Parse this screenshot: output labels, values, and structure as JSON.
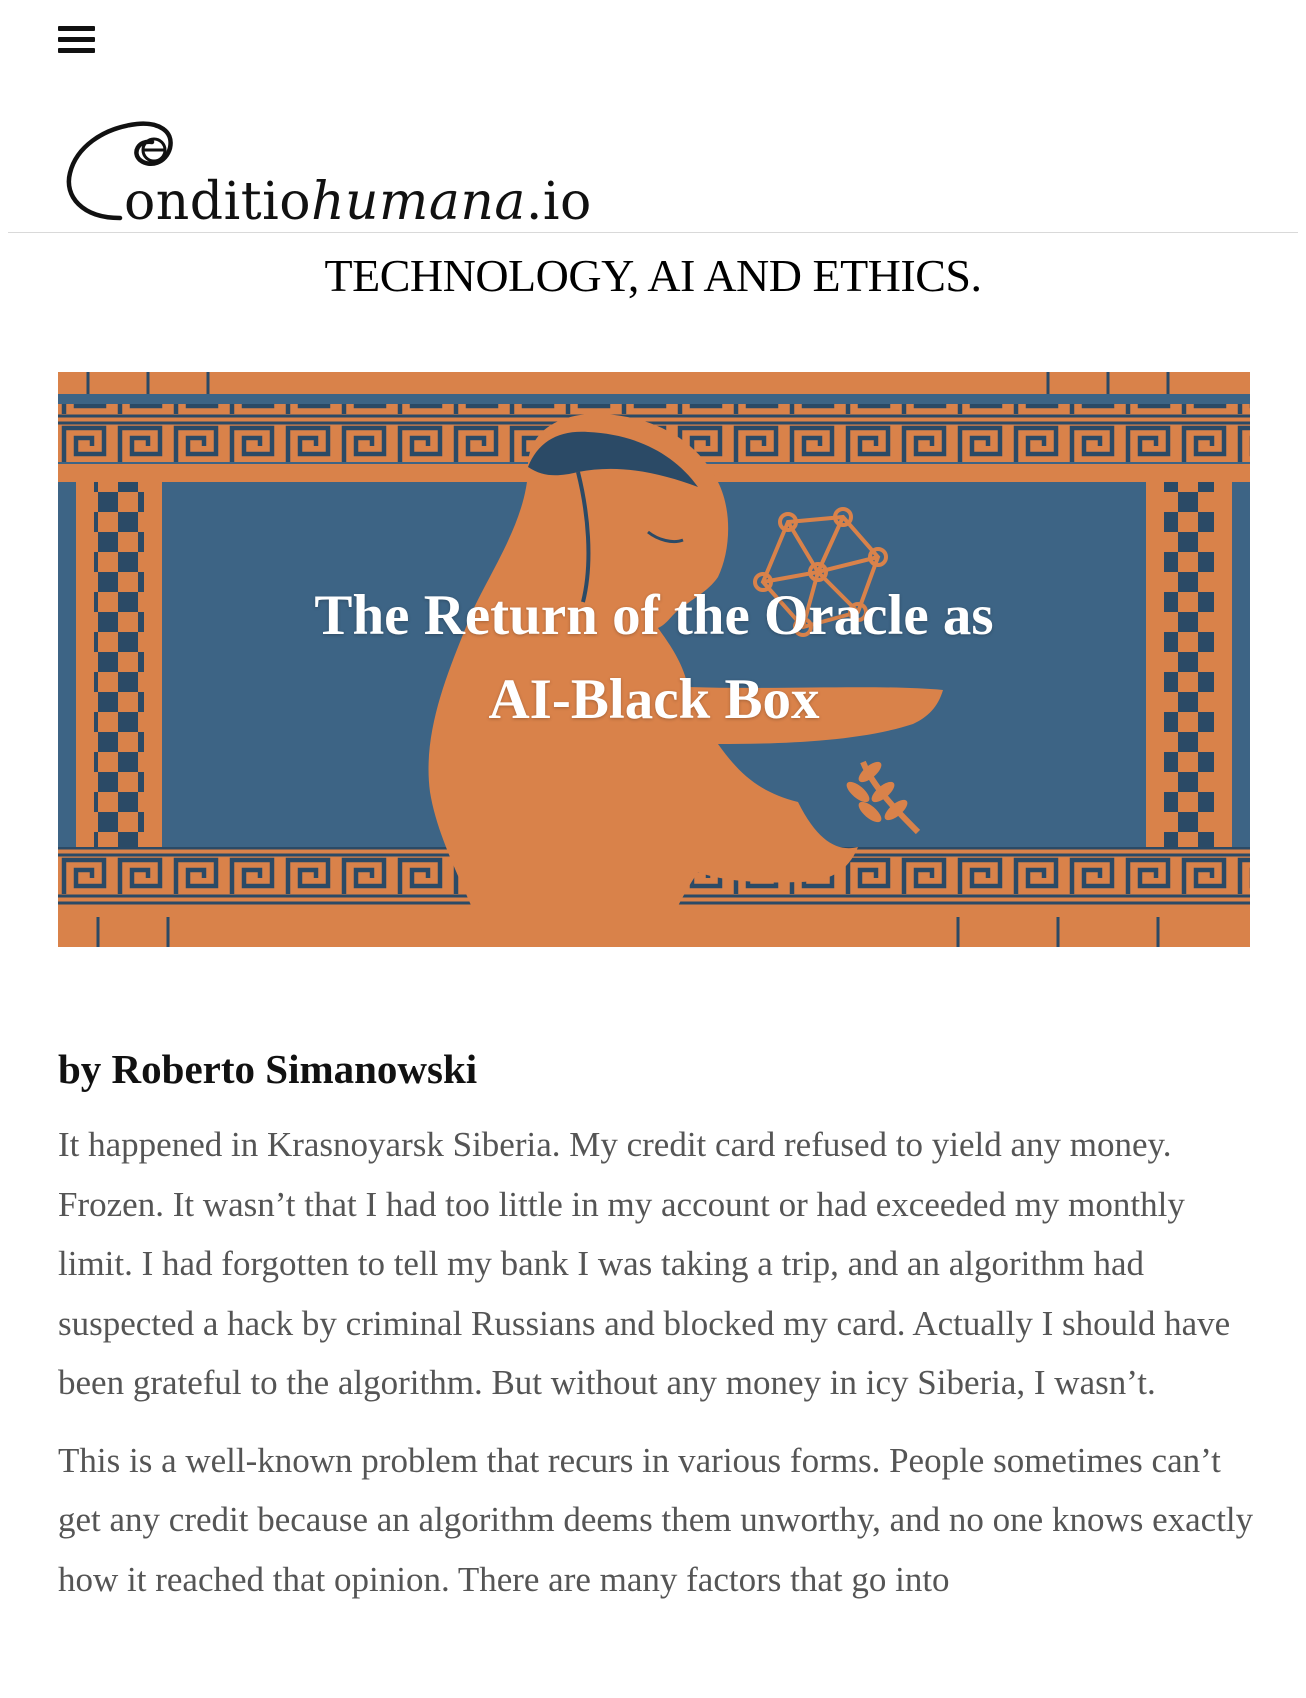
{
  "header": {
    "menu_icon": "hamburger-menu-icon",
    "logo": {
      "text_regular": "onditio",
      "text_italic": "humana",
      "text_suffix": ".io",
      "mark_icon": "condition-logo-mark"
    },
    "tagline": "TECHNOLOGY, AI AND ETHICS."
  },
  "hero": {
    "title_line1": "The Return of the Oracle as",
    "title_line2": "AI-Black Box",
    "colors": {
      "orange": "#D9824A",
      "blue": "#3D6485",
      "dark_blue": "#2B4A66"
    }
  },
  "article": {
    "byline": "by Roberto Simanowski",
    "paragraphs": [
      "It happened in Krasnoyarsk Siberia. My credit card refused to yield any money. Frozen. It wasn’t that I had too little in my account or had exceeded my monthly limit. I had forgotten to tell my bank I was taking a trip, and an algorithm had suspected a hack by criminal Russians and blocked my card. Actually I should have been grateful to the algorithm. But without any money in icy Siberia, I wasn’t.",
      "This is a well-known problem that recurs in various forms. People sometimes can’t get any credit because an algorithm deems them unworthy, and no one knows exactly how it reached that opinion. There are many factors that go into"
    ]
  }
}
